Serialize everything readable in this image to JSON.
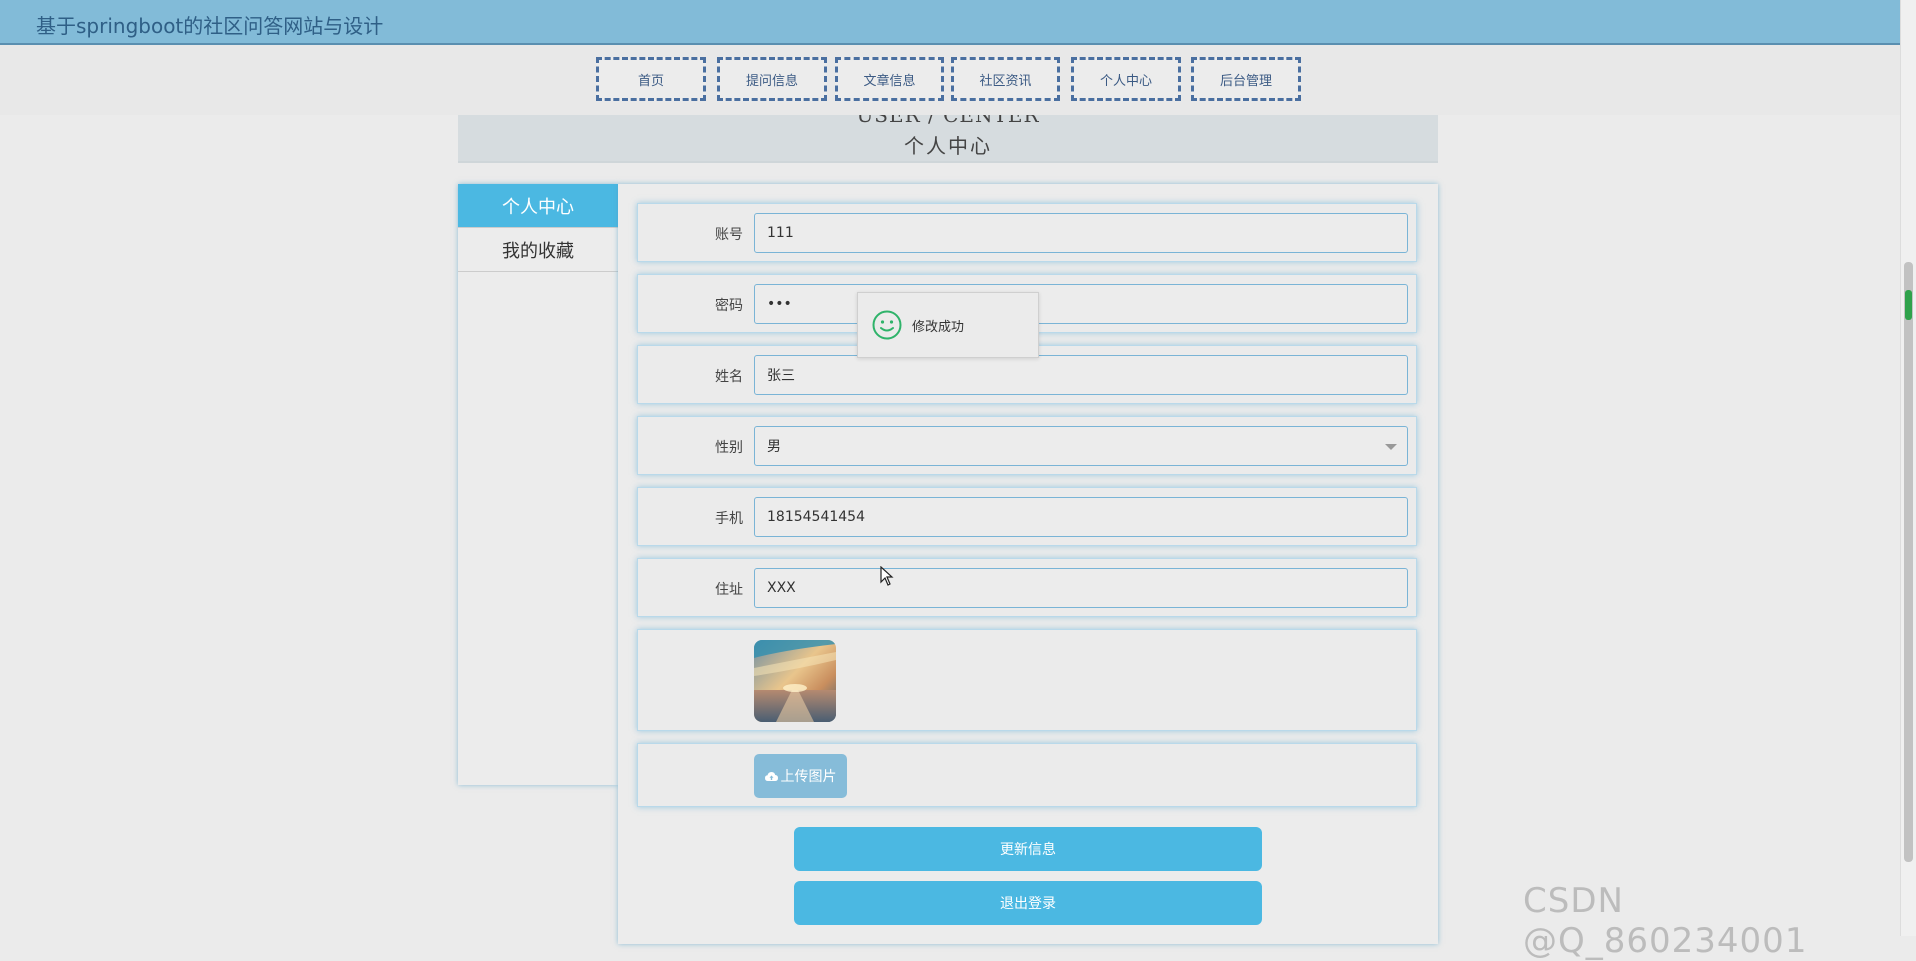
{
  "site": {
    "title": "基于springboot的社区问答网站与设计"
  },
  "nav": {
    "items": [
      {
        "label": "首页"
      },
      {
        "label": "提问信息"
      },
      {
        "label": "文章信息"
      },
      {
        "label": "社区资讯"
      },
      {
        "label": "个人中心"
      },
      {
        "label": "后台管理"
      }
    ]
  },
  "banner": {
    "en": "USER / CENTER",
    "cn": "个人中心"
  },
  "sidebar": {
    "items": [
      {
        "label": "个人中心",
        "active": true
      },
      {
        "label": "我的收藏",
        "active": false
      }
    ]
  },
  "form": {
    "account": {
      "label": "账号",
      "value": "111"
    },
    "password": {
      "label": "密码",
      "value": "•••"
    },
    "name": {
      "label": "姓名",
      "value": "张三"
    },
    "gender": {
      "label": "性别",
      "value": "男"
    },
    "phone": {
      "label": "手机",
      "value": "18154541454"
    },
    "address": {
      "label": "住址",
      "value": "XXX"
    },
    "upload_label": "上传图片",
    "update_label": "更新信息",
    "logout_label": "退出登录"
  },
  "toast": {
    "message": "修改成功",
    "icon": "smile-icon",
    "color": "#2fb36a"
  },
  "colors": {
    "topbar": "#82bbd8",
    "accent": "#4bb8e2",
    "nav_border": "#4a6fa0"
  },
  "watermark": "CSDN @Q_860234001"
}
